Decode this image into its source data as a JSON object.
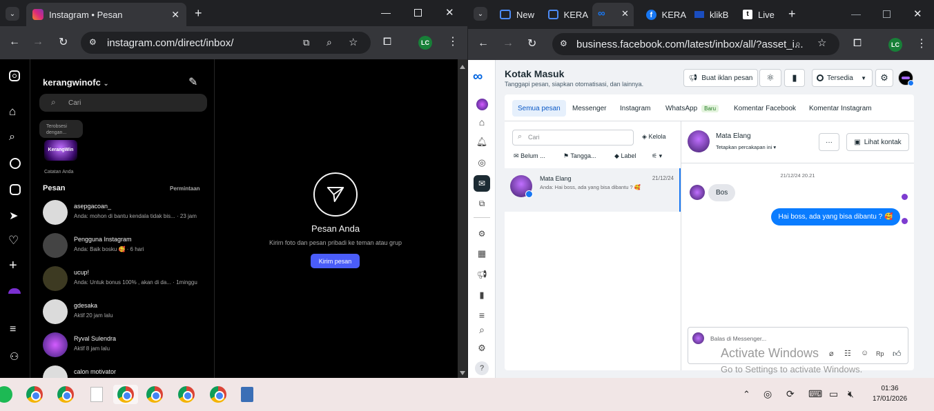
{
  "left_browser": {
    "tab_title": "Instagram • Pesan",
    "url": "instagram.com/direct/inbox/",
    "profile_initials": "LC"
  },
  "instagram": {
    "username": "kerangwinofc",
    "search_placeholder": "Cari",
    "note_bubble": "Terobsesi dengan...",
    "note_caption": "Catatan Anda",
    "messages_heading": "Pesan",
    "requests_link": "Permintaan",
    "conversations": [
      {
        "name": "asepgacoan_",
        "preview": "Anda: mohon di bantu kendala tidak bis...  · 23 jam"
      },
      {
        "name": "Pengguna Instagram",
        "preview": "Anda: Baik bosku 🥰  · 6 hari"
      },
      {
        "name": "ucup!",
        "preview": "Anda: Untuk bonus 100% , akan di da...  · 1minggu"
      },
      {
        "name": "gdesaka",
        "preview": "Aktif 20 jam lalu"
      },
      {
        "name": "Ryval Sulendra",
        "preview": "Aktif 8 jam lalu"
      },
      {
        "name": "calon motivator",
        "preview": ""
      }
    ],
    "empty_title": "Pesan Anda",
    "empty_sub": "Kirim foto dan pesan pribadi ke teman atau grup",
    "send_button": "Kirim pesan"
  },
  "right_browser": {
    "tabs": [
      "New",
      "KERA",
      "",
      "KERA",
      "klikB",
      "Live"
    ],
    "url": "business.facebook.com/latest/inbox/all/?asset_i...",
    "profile_initials": "LC"
  },
  "fb": {
    "title": "Kotak Masuk",
    "subtitle": "Tanggapi pesan, siapkan otomatisasi, dan lainnya.",
    "buy_ad": "Buat iklan pesan",
    "status": "Tersedia",
    "tabs": [
      "Semua pesan",
      "Messenger",
      "Instagram",
      "WhatsApp",
      "Komentar Facebook",
      "Komentar Instagram"
    ],
    "badge_new": "Baru",
    "search_placeholder": "Cari",
    "manage": "Kelola",
    "filters": [
      "Belum ...",
      "Tangga...",
      "Label"
    ],
    "thread": {
      "name": "Mata Elang",
      "date": "21/12/24",
      "preview": "Anda: Hai boss, ada yang bisa dibantu ? 🥰"
    },
    "chat_name": "Mata Elang",
    "chat_assign": "Tetapkan percakapan ini",
    "view_contact": "Lihat kontak",
    "timestamp": "21/12/24 20.21",
    "msg_in": "Bos",
    "msg_out": "Hai boss, ada yang bisa dibantu ? 🥰",
    "reply_placeholder": "Balas di Messenger...",
    "currency": "Rp"
  },
  "watermark": {
    "line1": "Activate Windows",
    "line2": "Go to Settings to activate Windows."
  },
  "taskbar": {
    "time": "01:36",
    "date": "17/01/2026"
  }
}
